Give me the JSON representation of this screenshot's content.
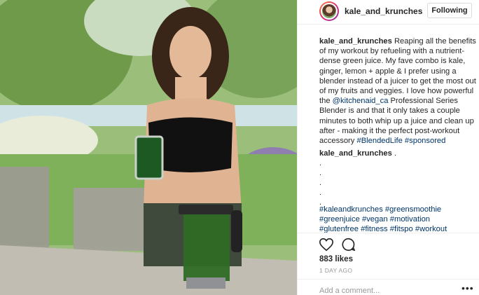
{
  "post": {
    "username": "kale_and_krunches",
    "follow_label": "Following",
    "caption_user": "kale_and_krunches",
    "caption_text_1": " Reaping all the benefits of my workout by refueling with a nutrient-dense green juice. My fave combo is kale, ginger, lemon + apple & I prefer using a blender instead of a juicer to get the most out of my fruits and veggies. I love how powerful the ",
    "caption_mention": "@kitchenaid_ca",
    "caption_text_2": " Professional Series Blender is and that it only takes a couple minutes to both whip up a juice and clean up after - making it the perfect post-workout accessory ",
    "caption_tag_1": "#BlendedLife",
    "caption_tag_2": "#sponsored",
    "comment_user": "kale_and_krunches",
    "comment_text": " .",
    "dots": [
      ".",
      ".",
      ".",
      ".",
      "."
    ],
    "tags": [
      "#kaleandkrunches",
      "#greensmoothie",
      "#greenjuice",
      "#vegan",
      "#motivation",
      "#glutenfree",
      "#fitness",
      "#fitspo",
      "#workout"
    ],
    "likes": "883 likes",
    "time": "1 DAY AGO",
    "add_comment_placeholder": "Add a comment...",
    "more_label": "•••",
    "icons": {
      "like": "heart-icon",
      "comment": "comment-icon"
    }
  }
}
